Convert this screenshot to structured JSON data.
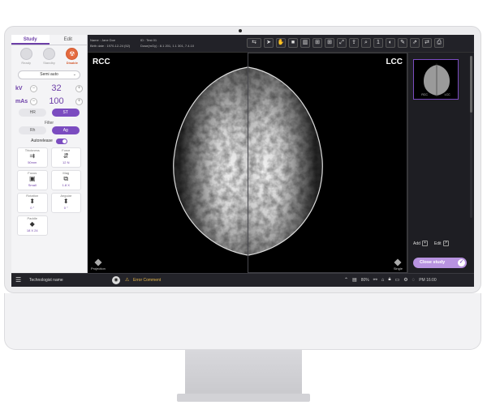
{
  "left_panel": {
    "tabs": [
      {
        "label": "Study"
      },
      {
        "label": "Edit"
      }
    ],
    "modes": [
      {
        "label": "Ready"
      },
      {
        "label": "Standby"
      },
      {
        "label": "Disable"
      }
    ],
    "exposure_mode": "Semi auto",
    "kv_label": "kV",
    "kv_value": "32",
    "mas_label": "mAs",
    "mas_value": "100",
    "resolution_options": [
      {
        "label": "HR"
      },
      {
        "label": "ST"
      }
    ],
    "filter_label": "Filter",
    "filter_options": [
      {
        "label": "Rh"
      },
      {
        "label": "Ag"
      }
    ],
    "autorelease_label": "Autorelease",
    "params": [
      {
        "title": "Thickness",
        "value": "50mm"
      },
      {
        "title": "Force",
        "value": "12 N"
      },
      {
        "title": "Focus",
        "value": "Small"
      },
      {
        "title": "Mag",
        "value": "1.8 X"
      },
      {
        "title": "Rotation",
        "value": "0 °"
      },
      {
        "title": "Angular",
        "value": "0 °"
      },
      {
        "title": "Paddle",
        "value": "18 X 24"
      }
    ]
  },
  "header": {
    "name": "Name : Jane Doe",
    "birth": "Birth date : 1970-12-24 (52)",
    "id": "ID : Test 01",
    "dose": "Dose(mGy) : 8.1 201, 1.1 301, 7.4.10"
  },
  "viewer": {
    "left_label": "RCC",
    "right_label": "LCC",
    "left_corner": "Projection",
    "right_corner": "Single"
  },
  "right_panel": {
    "thumb_left": "RCC",
    "thumb_right": "LCC",
    "add_label": "Add",
    "edit_label": "Edit",
    "close_study_label": "Close study"
  },
  "bottom_bar": {
    "technologist": "Technologist name",
    "error_comment": "Error Comment",
    "zoom": "80%",
    "time": "PM 16:00"
  },
  "colors": {
    "accent": "#7b4cc0",
    "disable": "#e46a3f",
    "warning": "#e8b84a"
  }
}
